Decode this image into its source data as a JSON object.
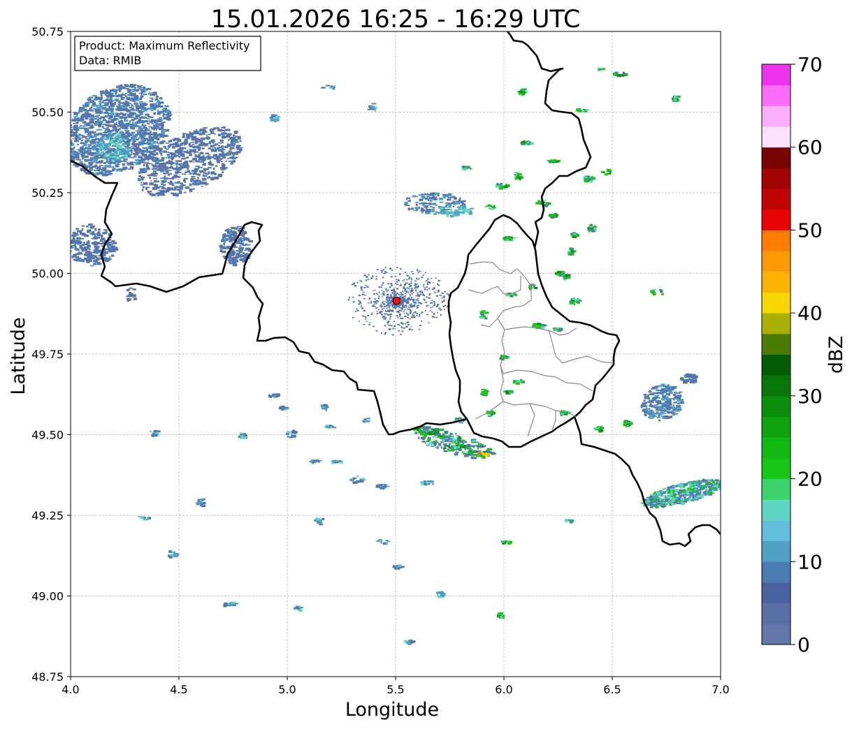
{
  "title": "15.01.2026 16:25 - 16:29 UTC",
  "info_box": {
    "product_line": "Product: Maximum Reflectivity",
    "data_line": "Data: RMIB"
  },
  "map": {
    "xlabel": "Longitude",
    "ylabel": "Latitude",
    "lon_range": [
      4.0,
      7.0
    ],
    "lat_range": [
      48.75,
      50.75
    ],
    "x_ticks": [
      {
        "value": 4.0,
        "label": "4.0"
      },
      {
        "value": 4.5,
        "label": "4.5"
      },
      {
        "value": 5.0,
        "label": "5.0"
      },
      {
        "value": 5.5,
        "label": "5.5"
      },
      {
        "value": 6.0,
        "label": "6.0"
      },
      {
        "value": 6.5,
        "label": "6.5"
      },
      {
        "value": 7.0,
        "label": "7.0"
      }
    ],
    "y_ticks": [
      {
        "value": 48.75,
        "label": "48.75"
      },
      {
        "value": 49.0,
        "label": "49.00"
      },
      {
        "value": 49.25,
        "label": "49.25"
      },
      {
        "value": 49.5,
        "label": "49.50"
      },
      {
        "value": 49.75,
        "label": "49.75"
      },
      {
        "value": 50.0,
        "label": "50.00"
      },
      {
        "value": 50.25,
        "label": "50.25"
      },
      {
        "value": 50.5,
        "label": "50.50"
      },
      {
        "value": 50.75,
        "label": "50.75"
      }
    ],
    "grid": true,
    "radar_site": {
      "lon": 5.505,
      "lat": 49.915,
      "color": "#ee1111"
    },
    "border_color": "#000000",
    "district_color": "#888888"
  },
  "colorbar": {
    "label": "dBZ",
    "range": [
      0,
      70
    ],
    "ticks": [
      {
        "value": 0,
        "label": "0"
      },
      {
        "value": 10,
        "label": "10"
      },
      {
        "value": 20,
        "label": "20"
      },
      {
        "value": 30,
        "label": "30"
      },
      {
        "value": 40,
        "label": "40"
      },
      {
        "value": 50,
        "label": "50"
      },
      {
        "value": 60,
        "label": "60"
      },
      {
        "value": 70,
        "label": "70"
      }
    ],
    "colors": [
      "#6577a8",
      "#5a6fa6",
      "#4b62a2",
      "#4a7cb4",
      "#51a0c6",
      "#62bedb",
      "#5fd6c3",
      "#3dd46c",
      "#17c617",
      "#13b913",
      "#0fa30f",
      "#0b8f0b",
      "#087608",
      "#045c04",
      "#4a7c04",
      "#aab004",
      "#f8d604",
      "#fcb404",
      "#fc9a04",
      "#fc7c04",
      "#e80404",
      "#c00404",
      "#a00404",
      "#780404",
      "#fde0fd",
      "#fbaefb",
      "#fb6cfb",
      "#ee33ee"
    ]
  },
  "echo_palette": {
    "weak": "#5a72a8",
    "light": "#4a7cb4",
    "blue_mid": "#51a0c6",
    "cyan": "#5fd6c3",
    "green": "#17c617",
    "green_dark": "#0b8f0b",
    "yellow": "#f8d604",
    "orange": "#fc9a04"
  }
}
